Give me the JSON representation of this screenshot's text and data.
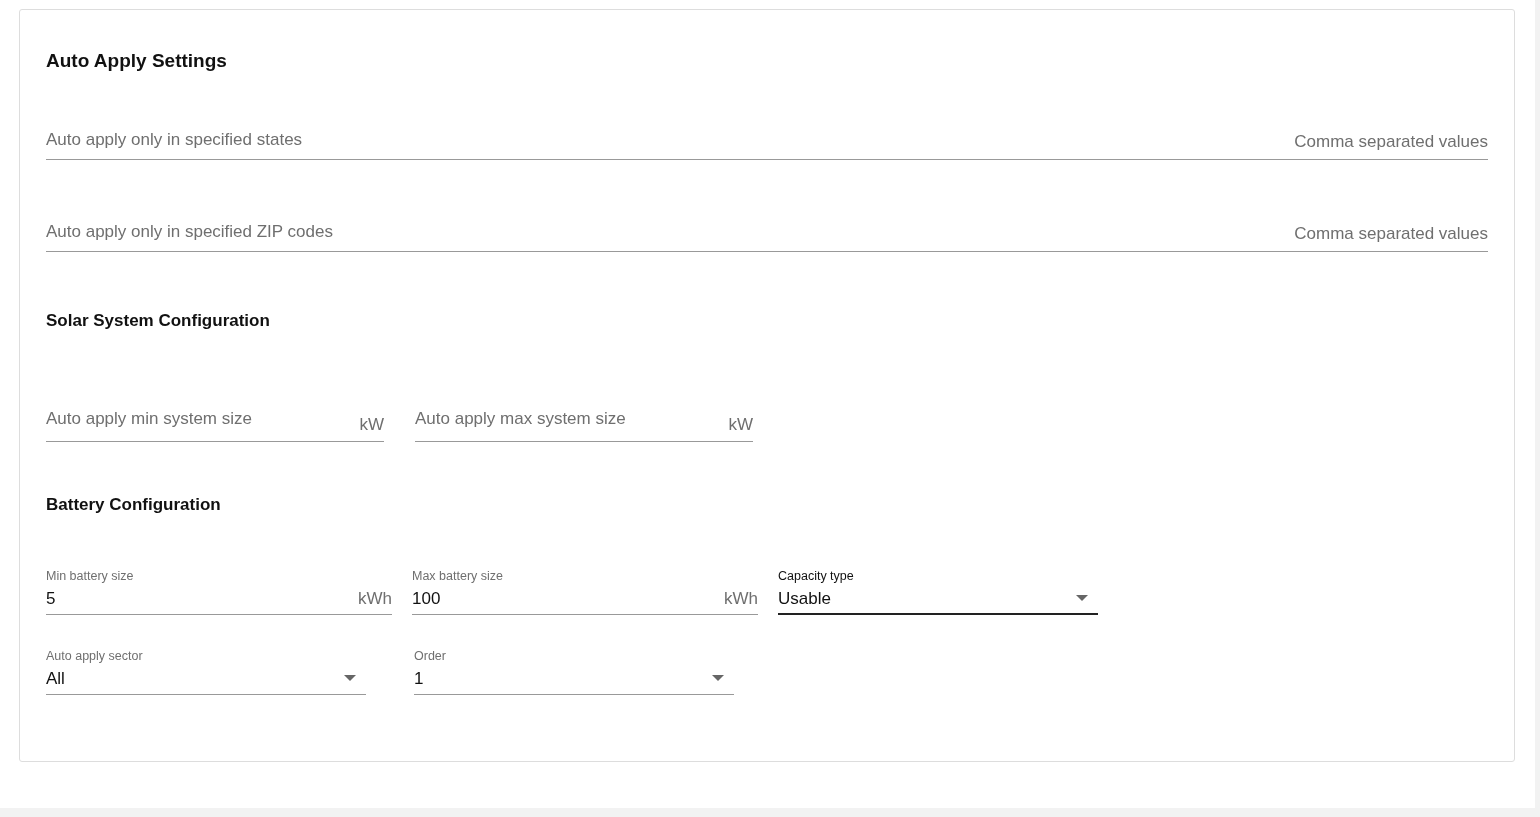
{
  "title": "Auto Apply Settings",
  "wide_fields": [
    {
      "placeholder": "Auto apply only in specified states",
      "hint": "Comma separated values"
    },
    {
      "placeholder": "Auto apply only in specified ZIP codes",
      "hint": "Comma separated values"
    }
  ],
  "solar": {
    "title": "Solar System Configuration",
    "fields": [
      {
        "placeholder": "Auto apply min system size",
        "suffix": "kW"
      },
      {
        "placeholder": "Auto apply max system size",
        "suffix": "kW"
      }
    ]
  },
  "battery": {
    "title": "Battery Configuration",
    "rows": [
      [
        {
          "kind": "text",
          "label": "Min battery size",
          "value": "5",
          "suffix": "kWh"
        },
        {
          "kind": "text",
          "label": "Max battery size",
          "value": "100",
          "suffix": "kWh"
        },
        {
          "kind": "select",
          "label": "Capacity type",
          "value": "Usable",
          "focused": true
        }
      ],
      [
        {
          "kind": "select",
          "label": "Auto apply sector",
          "value": "All",
          "focused": false
        },
        {
          "kind": "select",
          "label": "Order",
          "value": "1",
          "focused": false
        }
      ]
    ]
  }
}
